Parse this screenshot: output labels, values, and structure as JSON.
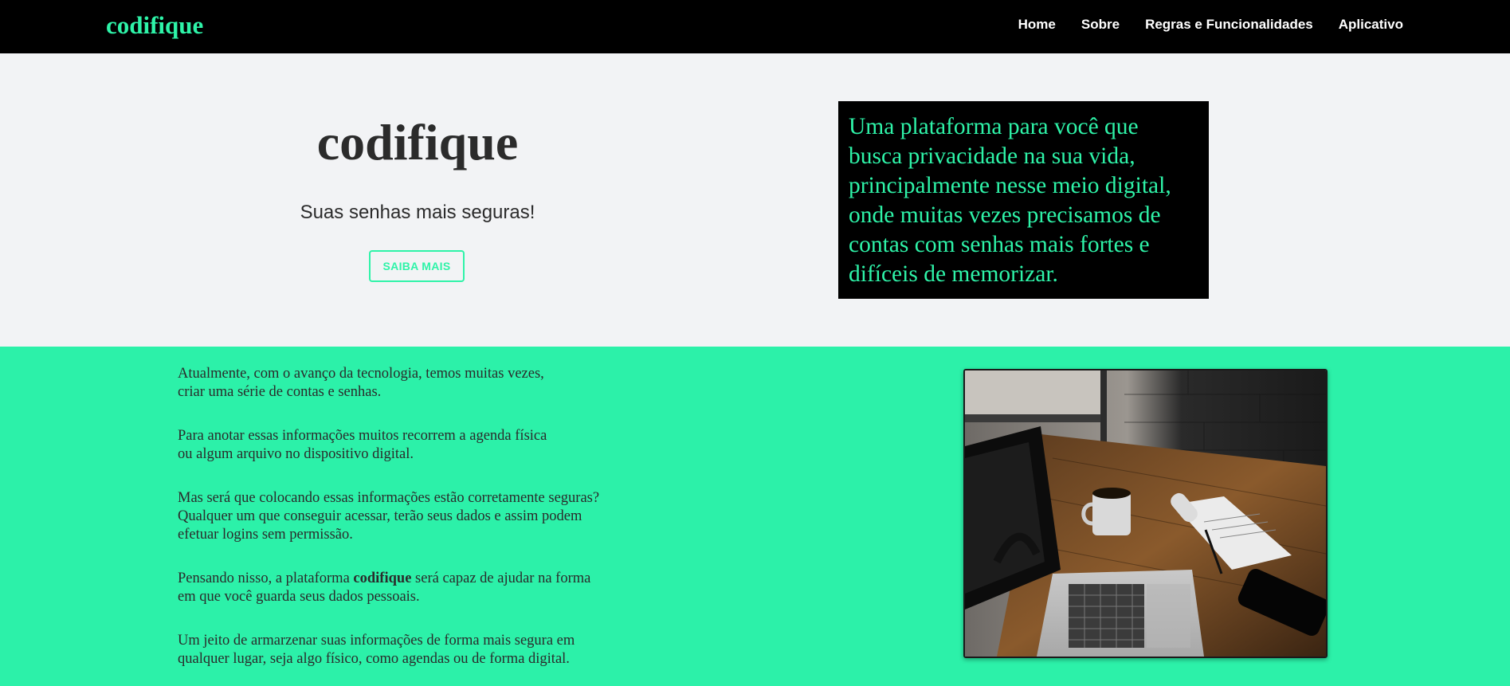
{
  "nav": {
    "brand": "codifique",
    "links": [
      "Home",
      "Sobre",
      "Regras e Funcionalidades",
      "Aplicativo"
    ]
  },
  "hero": {
    "title": "codifique",
    "subtitle": "Suas senhas mais seguras!",
    "button_label": "SAIBA MAIS",
    "box_lines": [
      "Uma plataforma para você que",
      "busca privacidade na sua vida,",
      "principalmente nesse meio digital,",
      "onde muitas vezes precisamos de",
      "contas com senhas mais fortes e",
      "difíceis de memorizar."
    ]
  },
  "about": {
    "p1": "Atualmente, com o avanço da tecnologia, temos muitas vezes,\ncriar uma série de contas e senhas.",
    "p2": "Para anotar essas informações muitos recorrem a agenda física\nou algum arquivo no dispositivo digital.",
    "p3": "Mas será que colocando essas informações estão corretamente seguras?\nQualquer um que conseguir acessar, terão seus dados e assim podem\nefetuar logins sem permissão.",
    "p4_before": "Pensando nisso, a plataforma ",
    "p4_brand": "codifique",
    "p4_after": " será capaz de ajudar na forma\nem que você guarda seus dados pessoais.",
    "p5": "Um jeito de armarzenar suas informações de forma mais segura em\nqualquer lugar, seja algo físico, como agendas ou de forma digital."
  },
  "colors": {
    "accent": "#2ef3a8",
    "section_bg": "#2cf1a9",
    "navbar_bg": "#000000",
    "hero_bg": "#f2f3f5",
    "text_dark": "#2b2b2b"
  }
}
